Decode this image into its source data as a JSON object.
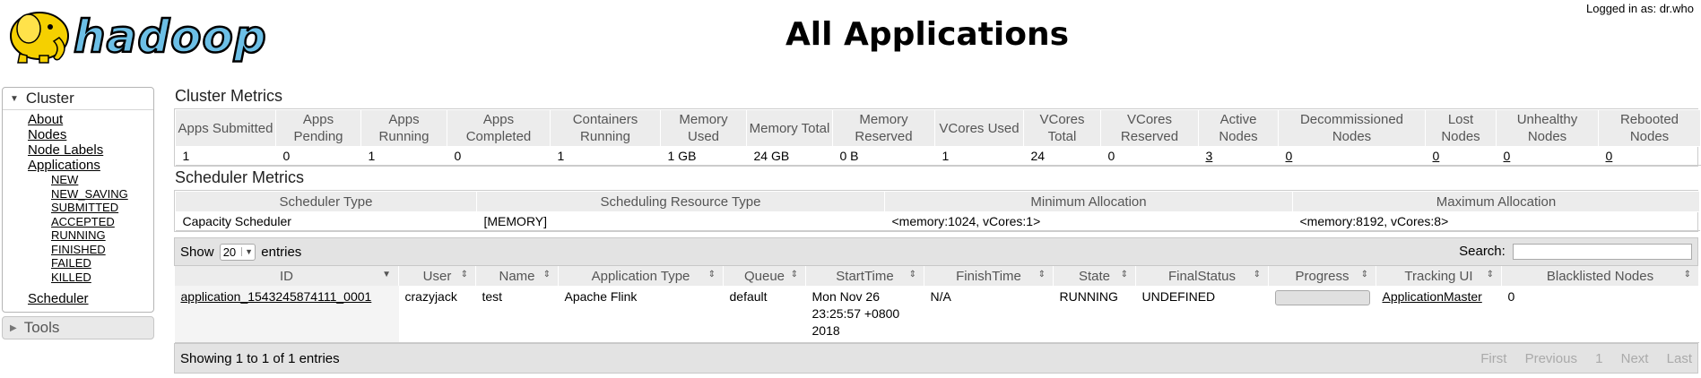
{
  "header": {
    "logo_text": "hadoop",
    "title": "All Applications",
    "logged_in": "Logged in as: dr.who"
  },
  "nav": {
    "cluster_label": "Cluster",
    "about": "About",
    "nodes": "Nodes",
    "node_labels": "Node Labels",
    "applications": "Applications",
    "states": [
      "NEW",
      "NEW_SAVING",
      "SUBMITTED",
      "ACCEPTED",
      "RUNNING",
      "FINISHED",
      "FAILED",
      "KILLED"
    ],
    "scheduler": "Scheduler",
    "tools_label": "Tools"
  },
  "cluster_metrics": {
    "title": "Cluster Metrics",
    "headers": [
      "Apps Submitted",
      "Apps Pending",
      "Apps Running",
      "Apps Completed",
      "Containers Running",
      "Memory Used",
      "Memory Total",
      "Memory Reserved",
      "VCores Used",
      "VCores Total",
      "VCores Reserved",
      "Active Nodes",
      "Decommissioned Nodes",
      "Lost Nodes",
      "Unhealthy Nodes",
      "Rebooted Nodes"
    ],
    "values": [
      "1",
      "0",
      "1",
      "0",
      "1",
      "1 GB",
      "24 GB",
      "0 B",
      "1",
      "24",
      "0",
      "3",
      "0",
      "0",
      "0",
      "0"
    ]
  },
  "scheduler_metrics": {
    "title": "Scheduler Metrics",
    "headers": [
      "Scheduler Type",
      "Scheduling Resource Type",
      "Minimum Allocation",
      "Maximum Allocation"
    ],
    "values": [
      "Capacity Scheduler",
      "[MEMORY]",
      "<memory:1024, vCores:1>",
      "<memory:8192, vCores:8>"
    ]
  },
  "apps": {
    "show_label": "Show",
    "page_size": "20",
    "entries_label": "entries",
    "search_label": "Search:",
    "search_value": "",
    "columns": [
      "ID",
      "User",
      "Name",
      "Application Type",
      "Queue",
      "StartTime",
      "FinishTime",
      "State",
      "FinalStatus",
      "Progress",
      "Tracking UI",
      "Blacklisted Nodes"
    ],
    "rows": [
      {
        "id": "application_1543245874111_0001",
        "user": "crazyjack",
        "name": "test",
        "type": "Apache Flink",
        "queue": "default",
        "start_line1": "Mon Nov 26",
        "start_line2": "23:25:57 +0800",
        "start_line3": "2018",
        "finish": "N/A",
        "state": "RUNNING",
        "final_status": "UNDEFINED",
        "progress": 0,
        "tracking_ui": "ApplicationMaster",
        "blacklisted": "0"
      }
    ],
    "info": "Showing 1 to 1 of 1 entries",
    "pager": [
      "First",
      "Previous",
      "1",
      "Next",
      "Last"
    ]
  },
  "colors": {
    "header_bg": "#ececec",
    "toolbar_bg": "#e3e3e3",
    "logo_yellow": "#f5d000",
    "logo_blue": "#6cbfe6"
  }
}
